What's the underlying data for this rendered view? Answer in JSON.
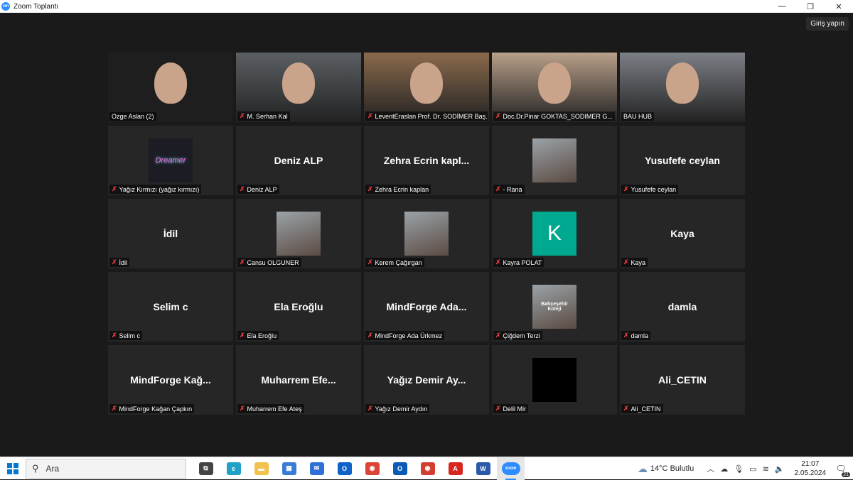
{
  "window": {
    "title": "Zoom Toplantı",
    "logo_text": "zm",
    "controls": {
      "minimize": "—",
      "restore": "❐",
      "close": "✕"
    }
  },
  "meeting": {
    "signin_label": "Giriş yapın",
    "participants": [
      {
        "label": "Ozge Aslan (2)",
        "display": "",
        "video": "person",
        "muted": false,
        "active": true
      },
      {
        "label": "M. Serhan Kal",
        "display": "",
        "video": "person",
        "muted": true
      },
      {
        "label": "LeventEraslan Prof. Dr. SODİMER Baş...",
        "display": "",
        "video": "person",
        "muted": true
      },
      {
        "label": "Doc.Dr.Pinar GOKTAS_SODIMER G...",
        "display": "",
        "video": "person",
        "muted": true
      },
      {
        "label": "BAU HUB",
        "display": "",
        "video": "person",
        "muted": false
      },
      {
        "label": "Yağız Kırmızı (yağız kırmızı)",
        "display": "",
        "avatar": "neon",
        "avatar_text": "Dreamer",
        "muted": true
      },
      {
        "label": "Deniz ALP",
        "display": "Deniz ALP",
        "muted": true
      },
      {
        "label": "Zehra Ecrin kaplan",
        "display": "Zehra Ecrin kapl...",
        "muted": true
      },
      {
        "label": "- Rana",
        "display": "",
        "avatar": "photo",
        "muted": true
      },
      {
        "label": "Yusufefe ceylan",
        "display": "Yusufefe ceylan",
        "muted": true
      },
      {
        "label": "İdil",
        "display": "İdil",
        "muted": true
      },
      {
        "label": "Cansu OLGUNER",
        "display": "",
        "avatar": "photo",
        "muted": true
      },
      {
        "label": "Kerem Çağırgan",
        "display": "",
        "avatar": "photo",
        "muted": true
      },
      {
        "label": "Kayra POLAT",
        "display": "",
        "avatar": "letter",
        "avatar_text": "K",
        "muted": true
      },
      {
        "label": "Kaya",
        "display": "Kaya",
        "muted": true
      },
      {
        "label": "Selim c",
        "display": "Selim c",
        "muted": true
      },
      {
        "label": "Ela Eroğlu",
        "display": "Ela Eroğlu",
        "muted": true
      },
      {
        "label": "MindForge Ada Ürkmez",
        "display": "MindForge Ada...",
        "muted": true
      },
      {
        "label": "Çiğdem Terzi",
        "display": "",
        "avatar": "photo",
        "avatar_text": "Bahçeşehir Koleji",
        "muted": true
      },
      {
        "label": "damla",
        "display": "damla",
        "muted": true
      },
      {
        "label": "MindForge Kağan Çapkın",
        "display": "MindForge Kağ...",
        "muted": true
      },
      {
        "label": "Muharrem Efe Ateş",
        "display": "Muharrem Efe...",
        "muted": true
      },
      {
        "label": "Yağız Demir Aydın",
        "display": "Yağız Demir Ay...",
        "muted": true
      },
      {
        "label": "Delil Mir",
        "display": "",
        "avatar": "black",
        "muted": true
      },
      {
        "label": "Ali_CETIN",
        "display": "Ali_CETIN",
        "muted": true
      }
    ]
  },
  "taskbar": {
    "search_placeholder": "Ara",
    "apps": [
      {
        "name": "task-view",
        "glyph": "⧉",
        "color": "#444444"
      },
      {
        "name": "edge",
        "glyph": "e",
        "color": "#1fa1c8"
      },
      {
        "name": "file-explorer",
        "glyph": "▬",
        "color": "#f2c14e"
      },
      {
        "name": "store",
        "glyph": "▦",
        "color": "#3a7bd5"
      },
      {
        "name": "mail",
        "glyph": "✉",
        "color": "#2f6fd6"
      },
      {
        "name": "outlook",
        "glyph": "O",
        "color": "#0f62c7"
      },
      {
        "name": "chrome",
        "glyph": "◉",
        "color": "#db4437"
      },
      {
        "name": "outlook-new",
        "glyph": "O",
        "color": "#0a5bb8"
      },
      {
        "name": "chrome-profile",
        "glyph": "◉",
        "color": "#d23f31"
      },
      {
        "name": "acrobat",
        "glyph": "A",
        "color": "#d7261e"
      },
      {
        "name": "word",
        "glyph": "W",
        "color": "#2b5aa8"
      },
      {
        "name": "zoom",
        "glyph": "zoom",
        "color": "#2d8cff",
        "active": true
      }
    ],
    "weather": {
      "temp": "14°C",
      "condition": "Bulutlu"
    },
    "clock": {
      "time": "21:07",
      "date": "2.05.2024"
    },
    "notifications": "21",
    "accent": "#2d8cff"
  }
}
